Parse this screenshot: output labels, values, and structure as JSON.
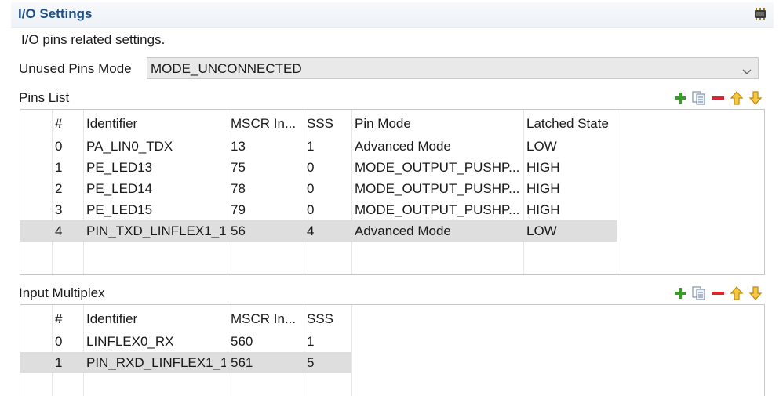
{
  "header": {
    "title": "I/O Settings",
    "icon": "chip-icon"
  },
  "description": "I/O pins related settings.",
  "unused_pins": {
    "label": "Unused Pins Mode",
    "value": "MODE_UNCONNECTED"
  },
  "pins_list": {
    "label": "Pins List",
    "columns": [
      "#",
      "Identifier",
      "MSCR In...",
      "SSS",
      "Pin Mode",
      "Latched State"
    ],
    "rows": [
      {
        "num": "0",
        "identifier": "PA_LIN0_TDX",
        "mscr": "13",
        "sss": "1",
        "pin_mode": "Advanced Mode",
        "latched": "LOW"
      },
      {
        "num": "1",
        "identifier": "PE_LED13",
        "mscr": "75",
        "sss": "0",
        "pin_mode": "MODE_OUTPUT_PUSHP...",
        "latched": "HIGH"
      },
      {
        "num": "2",
        "identifier": "PE_LED14",
        "mscr": "78",
        "sss": "0",
        "pin_mode": "MODE_OUTPUT_PUSHP...",
        "latched": "HIGH"
      },
      {
        "num": "3",
        "identifier": "PE_LED15",
        "mscr": "79",
        "sss": "0",
        "pin_mode": "MODE_OUTPUT_PUSHP...",
        "latched": "HIGH"
      },
      {
        "num": "4",
        "identifier": "PIN_TXD_LINFLEX1_1",
        "mscr": "56",
        "sss": "4",
        "pin_mode": "Advanced Mode",
        "latched": "LOW"
      }
    ],
    "selected_row": "4"
  },
  "input_multiplex": {
    "label": "Input Multiplex",
    "columns": [
      "#",
      "Identifier",
      "MSCR In...",
      "SSS"
    ],
    "rows": [
      {
        "num": "0",
        "identifier": "LINFLEX0_RX",
        "mscr": "560",
        "sss": "1"
      },
      {
        "num": "1",
        "identifier": "PIN_RXD_LINFLEX1_1",
        "mscr": "561",
        "sss": "5"
      }
    ],
    "selected_row": "1"
  },
  "toolbar_icons": [
    "add-icon",
    "copy-icon",
    "remove-icon",
    "move-up-icon",
    "move-down-icon"
  ],
  "colors": {
    "title": "#1f4f8a",
    "selection": "#dedede",
    "add": "#3a9a2a",
    "remove": "#d8262e",
    "arrow": "#e7a614"
  }
}
